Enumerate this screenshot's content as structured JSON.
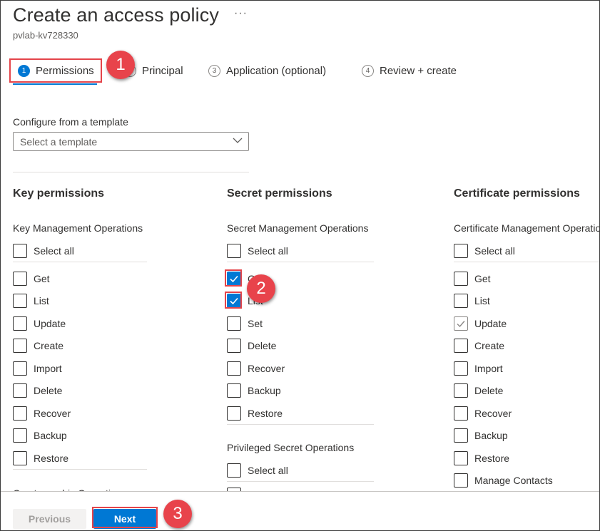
{
  "page": {
    "title": "Create an access policy",
    "more_label": "···",
    "subtitle": "pvlab-kv728330"
  },
  "tabs": [
    {
      "step": "1",
      "label": "Permissions",
      "active": true
    },
    {
      "step": "2",
      "label": "Principal",
      "active": false
    },
    {
      "step": "3",
      "label": "Application (optional)",
      "active": false
    },
    {
      "step": "4",
      "label": "Review + create",
      "active": false
    }
  ],
  "template": {
    "label": "Configure from a template",
    "placeholder": "Select a template"
  },
  "key_permissions": {
    "heading": "Key permissions",
    "group": "Key Management Operations",
    "select_all": "Select all",
    "items": [
      "Get",
      "List",
      "Update",
      "Create",
      "Import",
      "Delete",
      "Recover",
      "Backup",
      "Restore"
    ],
    "next_group_partial": "Cryptographic Operations"
  },
  "secret_permissions": {
    "heading": "Secret permissions",
    "group": "Secret Management Operations",
    "select_all": "Select all",
    "items": [
      "Get",
      "List",
      "Set",
      "Delete",
      "Recover",
      "Backup",
      "Restore"
    ],
    "checked": [
      "Get",
      "List"
    ],
    "privileged_group": "Privileged Secret Operations",
    "privileged_select_all": "Select all"
  },
  "certificate_permissions": {
    "heading": "Certificate permissions",
    "group": "Certificate Management Operations",
    "select_all": "Select all",
    "items": [
      "Get",
      "List",
      "Update",
      "Create",
      "Import",
      "Delete",
      "Recover",
      "Backup",
      "Restore",
      "Manage Contacts"
    ],
    "checked": [
      "Update"
    ]
  },
  "callouts": [
    "1",
    "2",
    "3"
  ],
  "footer": {
    "previous_label": "Previous",
    "next_label": "Next"
  },
  "colors": {
    "accent": "#0078d4",
    "callout": "#e8434b"
  }
}
